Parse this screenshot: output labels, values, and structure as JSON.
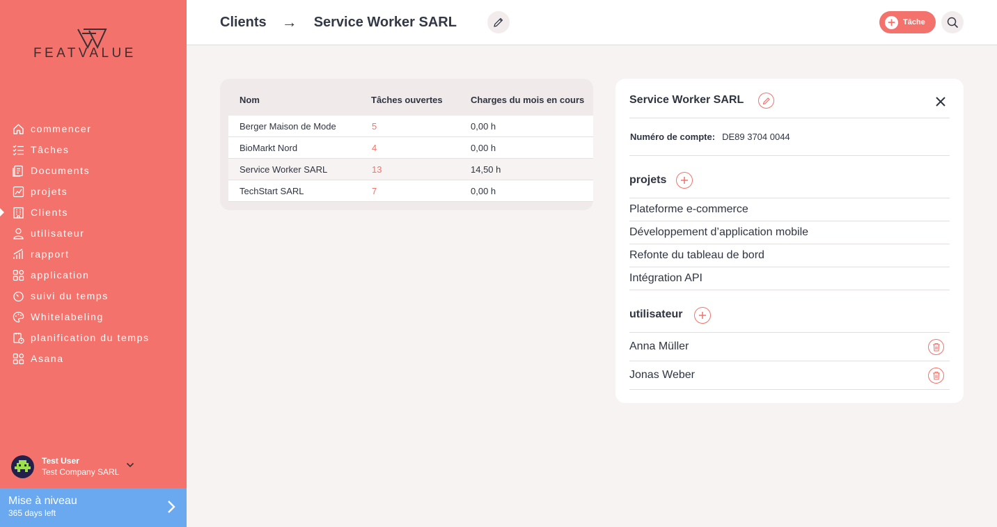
{
  "brand": {
    "name": "FEATVALUE"
  },
  "colors": {
    "accent": "#f3726b",
    "upgrade": "#6aa9f0",
    "text": "#2f3441"
  },
  "sidebar": {
    "items": [
      {
        "label": "commencer",
        "icon": "home-icon"
      },
      {
        "label": "Tâches",
        "icon": "checklist-icon"
      },
      {
        "label": "Documents",
        "icon": "document-icon"
      },
      {
        "label": "projets",
        "icon": "chart-board-icon"
      },
      {
        "label": "Clients",
        "icon": "building-icon",
        "active": true
      },
      {
        "label": "utilisateur",
        "icon": "user-icon"
      },
      {
        "label": "rapport",
        "icon": "bars-icon"
      },
      {
        "label": "application",
        "icon": "apps-icon"
      },
      {
        "label": "suivi du temps",
        "icon": "timer-icon"
      },
      {
        "label": "Whitelabeling",
        "icon": "palette-icon"
      },
      {
        "label": "planification du temps",
        "icon": "calendar-clock-icon"
      },
      {
        "label": "Asana",
        "icon": "apps-icon"
      }
    ],
    "user": {
      "name": "Test User",
      "company": "Test Company SARL"
    },
    "upgrade": {
      "title": "Mise à niveau",
      "subtitle": "365 days left"
    }
  },
  "header": {
    "breadcrumb_root": "Clients",
    "breadcrumb_sep": "→",
    "breadcrumb_current": "Service Worker SARL",
    "task_button": "Tâche"
  },
  "table": {
    "headers": [
      "Nom",
      "Tâches ouvertes",
      "Charges du mois en cours"
    ],
    "rows": [
      {
        "name": "Berger Maison de Mode",
        "open_tasks": "5",
        "charges": "0,00 h"
      },
      {
        "name": "BioMarkt Nord",
        "open_tasks": "4",
        "charges": "0,00 h"
      },
      {
        "name": "Service Worker SARL",
        "open_tasks": "13",
        "charges": "14,50 h"
      },
      {
        "name": "TechStart SARL",
        "open_tasks": "7",
        "charges": "0,00 h"
      }
    ]
  },
  "detail": {
    "title": "Service Worker SARL",
    "account_label": "Numéro de compte:",
    "account_value": "DE89 3704 0044",
    "projects_title": "projets",
    "projects": [
      "Plateforme e-commerce",
      "Développement d’application mobile",
      "Refonte du tableau de bord",
      "Intégration API"
    ],
    "users_title": "utilisateur",
    "users": [
      "Anna Müller",
      "Jonas Weber"
    ]
  }
}
